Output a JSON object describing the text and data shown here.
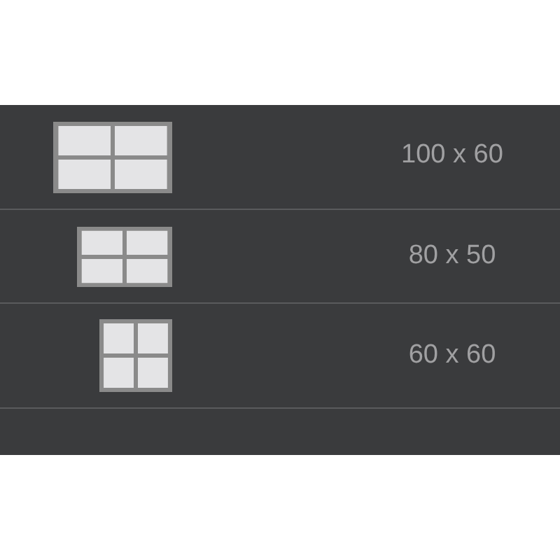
{
  "sizes": [
    {
      "label": "100 x 60"
    },
    {
      "label": "80 x 50"
    },
    {
      "label": "60 x 60"
    }
  ]
}
